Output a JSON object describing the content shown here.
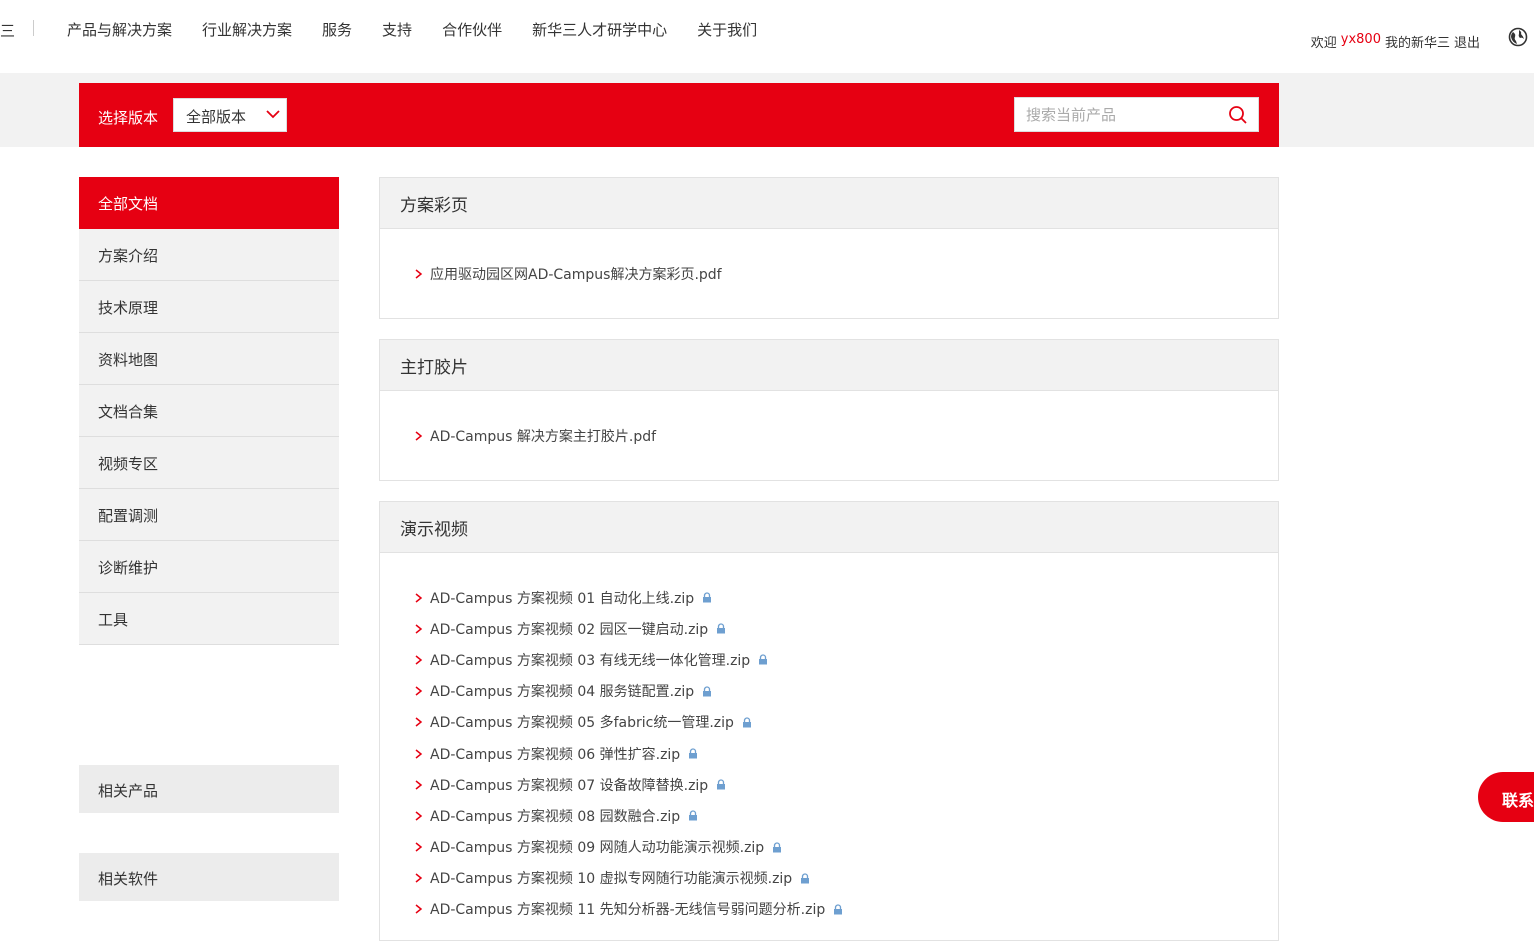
{
  "nav": {
    "logo_fragment": "三",
    "items": [
      "产品与解决方案",
      "行业解决方案",
      "服务",
      "支持",
      "合作伙伴",
      "新华三人才研学中心",
      "关于我们"
    ]
  },
  "user": {
    "welcome": "欢迎",
    "username": "yx800",
    "my_link": "我的新华三",
    "logout": "退出",
    "globe_icon": "globe-icon"
  },
  "filter": {
    "version_label": "选择版本",
    "version_value": "全部版本",
    "search_placeholder": "搜索当前产品"
  },
  "sidebar": {
    "items": [
      "全部文档",
      "方案介绍",
      "技术原理",
      "资料地图",
      "文档合集",
      "视频专区",
      "配置调测",
      "诊断维护",
      "工具"
    ],
    "related_products": "相关产品",
    "related_software": "相关软件"
  },
  "sections": [
    {
      "title": "方案彩页",
      "files": [
        {
          "name": "应用驱动园区网AD-Campus解决方案彩页.pdf",
          "locked": false
        }
      ]
    },
    {
      "title": "主打胶片",
      "files": [
        {
          "name": "AD-Campus 解决方案主打胶片.pdf",
          "locked": false
        }
      ]
    },
    {
      "title": "演示视频",
      "files": [
        {
          "name": "AD-Campus 方案视频 01 自动化上线.zip",
          "locked": true
        },
        {
          "name": "AD-Campus 方案视频 02 园区一键启动.zip",
          "locked": true
        },
        {
          "name": "AD-Campus 方案视频 03 有线无线一体化管理.zip",
          "locked": true
        },
        {
          "name": "AD-Campus 方案视频 04 服务链配置.zip",
          "locked": true
        },
        {
          "name": "AD-Campus 方案视频 05 多fabric统一管理.zip",
          "locked": true
        },
        {
          "name": "AD-Campus 方案视频 06 弹性扩容.zip",
          "locked": true
        },
        {
          "name": "AD-Campus 方案视频 07 设备故障替换.zip",
          "locked": true
        },
        {
          "name": "AD-Campus 方案视频 08 园数融合.zip",
          "locked": true
        },
        {
          "name": "AD-Campus 方案视频 09 网随人动功能演示视频.zip",
          "locked": true
        },
        {
          "name": "AD-Campus 方案视频 10 虚拟专网随行功能演示视频.zip",
          "locked": true
        },
        {
          "name": "AD-Campus 方案视频 11 先知分析器-无线信号弱问题分析.zip",
          "locked": true
        }
      ]
    }
  ],
  "contact": {
    "label": "联系"
  },
  "colors": {
    "brand_red": "#e60012",
    "lock_blue": "#6e9fd0"
  }
}
